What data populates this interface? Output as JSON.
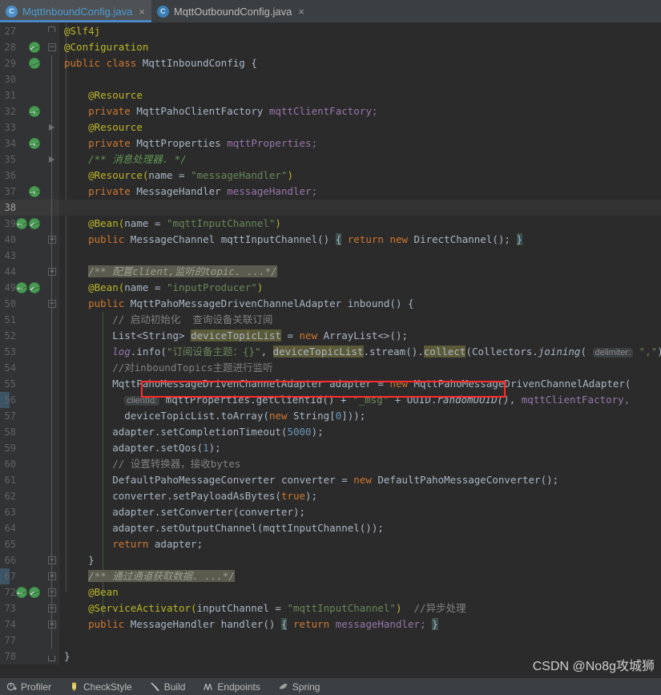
{
  "tabs": [
    {
      "label": "MqttInboundConfig.java",
      "icon": "java-class-icon",
      "letter": "C",
      "active": true,
      "close": "×"
    },
    {
      "label": "MqttOutboundConfig.java",
      "icon": "java-class-icon",
      "letter": "C",
      "active": false,
      "close": "×"
    }
  ],
  "editor": {
    "lines": [
      {
        "n": "27",
        "indent": 0
      },
      {
        "n": "28",
        "indent": 0
      },
      {
        "n": "29",
        "indent": 0
      },
      {
        "n": "30",
        "indent": 0
      },
      {
        "n": "31",
        "indent": 0
      },
      {
        "n": "32",
        "indent": 0
      },
      {
        "n": "33",
        "indent": 0
      },
      {
        "n": "34",
        "indent": 0
      },
      {
        "n": "35",
        "indent": 0
      },
      {
        "n": "36",
        "indent": 0
      },
      {
        "n": "37",
        "indent": 0
      },
      {
        "n": "38",
        "indent": 0
      },
      {
        "n": "39",
        "indent": 0
      },
      {
        "n": "40",
        "indent": 0
      },
      {
        "n": "43",
        "indent": 0
      },
      {
        "n": "44",
        "indent": 0
      },
      {
        "n": "49",
        "indent": 0
      },
      {
        "n": "50",
        "indent": 0
      },
      {
        "n": "51",
        "indent": 0
      },
      {
        "n": "52",
        "indent": 0
      },
      {
        "n": "53",
        "indent": 0
      },
      {
        "n": "54",
        "indent": 0
      },
      {
        "n": "55",
        "indent": 0
      },
      {
        "n": "56",
        "indent": 0
      },
      {
        "n": "57",
        "indent": 0
      },
      {
        "n": "58",
        "indent": 0
      },
      {
        "n": "59",
        "indent": 0
      },
      {
        "n": "60",
        "indent": 0
      },
      {
        "n": "61",
        "indent": 0
      },
      {
        "n": "62",
        "indent": 0
      },
      {
        "n": "63",
        "indent": 0
      },
      {
        "n": "64",
        "indent": 0
      },
      {
        "n": "65",
        "indent": 0
      },
      {
        "n": "66",
        "indent": 0
      },
      {
        "n": "67",
        "indent": 0
      },
      {
        "n": "72",
        "indent": 0
      },
      {
        "n": "73",
        "indent": 0
      },
      {
        "n": "74",
        "indent": 0
      },
      {
        "n": "77",
        "indent": 0
      },
      {
        "n": "78",
        "indent": 0
      }
    ],
    "code": {
      "l27": "@Slf4j",
      "l28": "@Configuration",
      "l29_kw": "public class",
      "l29_name": "MqttInboundConfig",
      "l29_brace": "{",
      "l31": "@Resource",
      "l32_kw": "private",
      "l32_type": "MqttPahoClientFactory",
      "l32_field": "mqttClientFactory;",
      "l33": "@Resource",
      "l34_kw": "private",
      "l34_type": "MqttProperties",
      "l34_field": "mqttProperties;",
      "l35_doc": "/** 消息处理器. */",
      "l36_ann": "@Resource(",
      "l36_name": "name",
      "l36_eq": " = ",
      "l36_str": "\"messageHandler\"",
      "l36_close": ")",
      "l37_kw": "private",
      "l37_type": "MessageHandler",
      "l37_field": "messageHandler;",
      "l39_ann": "@Bean(",
      "l39_name": "name",
      "l39_eq": " = ",
      "l39_str": "\"mqttInputChannel\"",
      "l39_close": ")",
      "l40_kw": "public",
      "l40_type": "MessageChannel",
      "l40_mth": "mqttInputChannel()",
      "l40_ob": "{",
      "l40_return": "return",
      "l40_new": "new",
      "l40_dc": "DirectChannel();",
      "l40_cb": "}",
      "l44_fold": "/** 配置client,监听的topic. ...*/",
      "l49_ann": "@Bean(",
      "l49_name": "name",
      "l49_eq": " = ",
      "l49_str": "\"inputProducer\"",
      "l49_close": ")",
      "l50_kw": "public",
      "l50_type": "MqttPahoMessageDrivenChannelAdapter",
      "l50_mth": "inbound()",
      "l50_brace": "{",
      "l51_cmt": "// 启动初始化  查询设备关联订阅",
      "l52_type": "List<String>",
      "l52_var": "deviceTopicList",
      "l52_eq": " = ",
      "l52_new": "new",
      "l52_ctor": "ArrayList<>();",
      "l53_log": "log",
      "l53_info": ".info(",
      "l53_str": "\"订阅设备主题：{}\"",
      "l53_comma": ", ",
      "l53_var": "deviceTopicList",
      "l53_stream": ".stream().",
      "l53_collect": "collect",
      "l53_colopen": "(Collectors.",
      "l53_joining": "joining",
      "l53_paren": "( ",
      "l53_hint": "delimiter:",
      "l53_delim": " \",\"",
      "l53_end": "));",
      "l54_cmt": "//对inboundTopics主题进行监听",
      "l55_type": "MqttPahoMessageDrivenChannelAdapter",
      "l55_var": " adapter = ",
      "l55_new": "new",
      "l55_ctor": "MqttPahoMessageDrivenChannelAdapter(",
      "l56_hint": "clientId:",
      "l56_a": "mqttProperties.getClientId() + ",
      "l56_str": "\"_msg\"",
      "l56_plus": " + UUID.",
      "l56_stat": "randomUUID()",
      "l56_comma": ", ",
      "l56_factory": "mqttClientFactory,",
      "l57": "deviceTopicList.toArray(",
      "l57_new": "new",
      "l57_str": " String[",
      "l57_num": "0",
      "l57_end": "]));",
      "l58_a": "adapter.setCompletionTimeout(",
      "l58_num": "5000",
      "l58_end": ");",
      "l59_a": "adapter.setQos(",
      "l59_num": "1",
      "l59_end": ");",
      "l60_cmt": "// 设置转换器，接收bytes",
      "l61_type": "DefaultPahoMessageConverter",
      "l61_var": " converter = ",
      "l61_new": "new",
      "l61_ctor": "DefaultPahoMessageConverter();",
      "l62_a": "converter.setPayloadAsBytes(",
      "l62_kw": "true",
      "l62_end": ");",
      "l63": "adapter.setConverter(converter);",
      "l64": "adapter.setOutputChannel(mqttInputChannel());",
      "l65_kw": "return",
      "l65_var": " adapter;",
      "l66": "}",
      "l67_fold": "/** 通过通道获取数据. ...*/",
      "l72": "@Bean",
      "l73_ann": "@ServiceActivator(",
      "l73_name": "inputChannel",
      "l73_eq": " = ",
      "l73_str": "\"mqttInputChannel\"",
      "l73_close": ")",
      "l73_cmt": "  //异步处理",
      "l74_kw": "public",
      "l74_type": "MessageHandler",
      "l74_mth": "handler()",
      "l74_ob": "{",
      "l74_return": "return",
      "l74_field": "messageHandler;",
      "l74_cb": "}",
      "l78": "}"
    },
    "watermark": "CSDN @No8g攻城狮",
    "annotation_color": "#ff2b2b"
  },
  "statusbar": {
    "items": [
      {
        "label": "Profiler",
        "icon": "profiler-icon"
      },
      {
        "label": "CheckStyle",
        "icon": "checkstyle-pencil-icon"
      },
      {
        "label": "Build",
        "icon": "build-hammer-icon"
      },
      {
        "label": "Endpoints",
        "icon": "endpoints-icon"
      },
      {
        "label": "Spring",
        "icon": "spring-leaf-icon"
      }
    ]
  }
}
